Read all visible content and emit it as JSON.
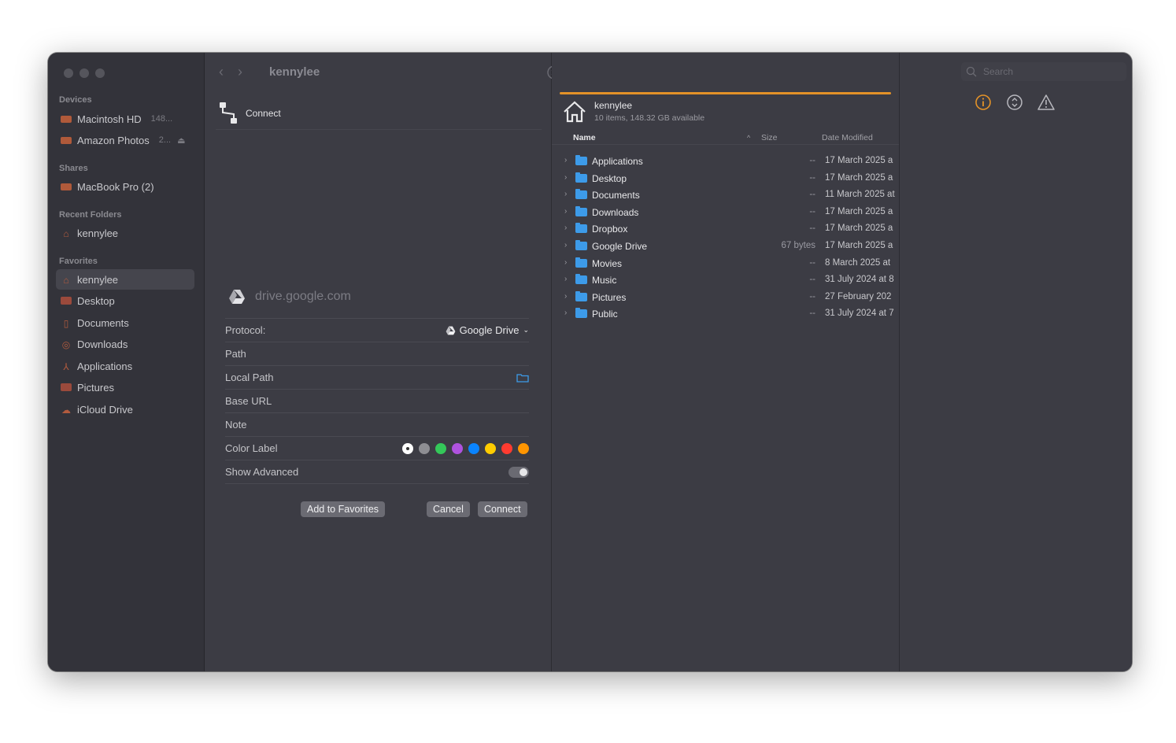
{
  "sidebar": {
    "sections": {
      "devices": "Devices",
      "shares": "Shares",
      "recent": "Recent Folders",
      "favorites": "Favorites"
    },
    "devices": [
      {
        "label": "Macintosh HD",
        "meta": "148..."
      },
      {
        "label": "Amazon Photos",
        "meta": "2..."
      }
    ],
    "shares": [
      {
        "label": "MacBook Pro (2)"
      }
    ],
    "recent": [
      {
        "label": "kennylee"
      }
    ],
    "favorites": [
      {
        "label": "kennylee"
      },
      {
        "label": "Desktop"
      },
      {
        "label": "Documents"
      },
      {
        "label": "Downloads"
      },
      {
        "label": "Applications"
      },
      {
        "label": "Pictures"
      },
      {
        "label": "iCloud Drive"
      }
    ]
  },
  "header": {
    "path_title": "kennylee",
    "search_placeholder": "Search"
  },
  "connect": {
    "title": "Connect",
    "server": "drive.google.com",
    "fields": {
      "protocol_label": "Protocol:",
      "protocol_value": "Google Drive",
      "path_label": "Path",
      "local_path_label": "Local Path",
      "base_url_label": "Base URL",
      "note_label": "Note",
      "color_label": "Color Label",
      "show_advanced_label": "Show Advanced"
    },
    "color_swatches": [
      "#ffffff",
      "#8e8e93",
      "#34c759",
      "#af52de",
      "#0a84ff",
      "#ffcc00",
      "#ff3b30",
      "#ff9500"
    ],
    "buttons": {
      "favorites": "Add to Favorites",
      "cancel": "Cancel",
      "connect": "Connect"
    }
  },
  "browser": {
    "location_name": "kennylee",
    "location_info": "10 items, 148.32 GB available",
    "columns": {
      "name": "Name",
      "size": "Size",
      "date": "Date Modified"
    },
    "rows": [
      {
        "name": "Applications",
        "size": "--",
        "date": "17 March 2025 a"
      },
      {
        "name": "Desktop",
        "size": "--",
        "date": "17 March 2025 a"
      },
      {
        "name": "Documents",
        "size": "--",
        "date": "11 March 2025 at"
      },
      {
        "name": "Downloads",
        "size": "--",
        "date": "17 March 2025 a"
      },
      {
        "name": "Dropbox",
        "size": "--",
        "date": "17 March 2025 a"
      },
      {
        "name": "Google Drive",
        "size": "67 bytes",
        "date": "17 March 2025 a"
      },
      {
        "name": "Movies",
        "size": "--",
        "date": "8 March 2025 at"
      },
      {
        "name": "Music",
        "size": "--",
        "date": "31 July 2024 at 8"
      },
      {
        "name": "Pictures",
        "size": "--",
        "date": "27 February 202"
      },
      {
        "name": "Public",
        "size": "--",
        "date": "31 July 2024 at 7"
      }
    ]
  },
  "colors": {
    "accent": "#e39228",
    "folder": "#3d9be9"
  }
}
